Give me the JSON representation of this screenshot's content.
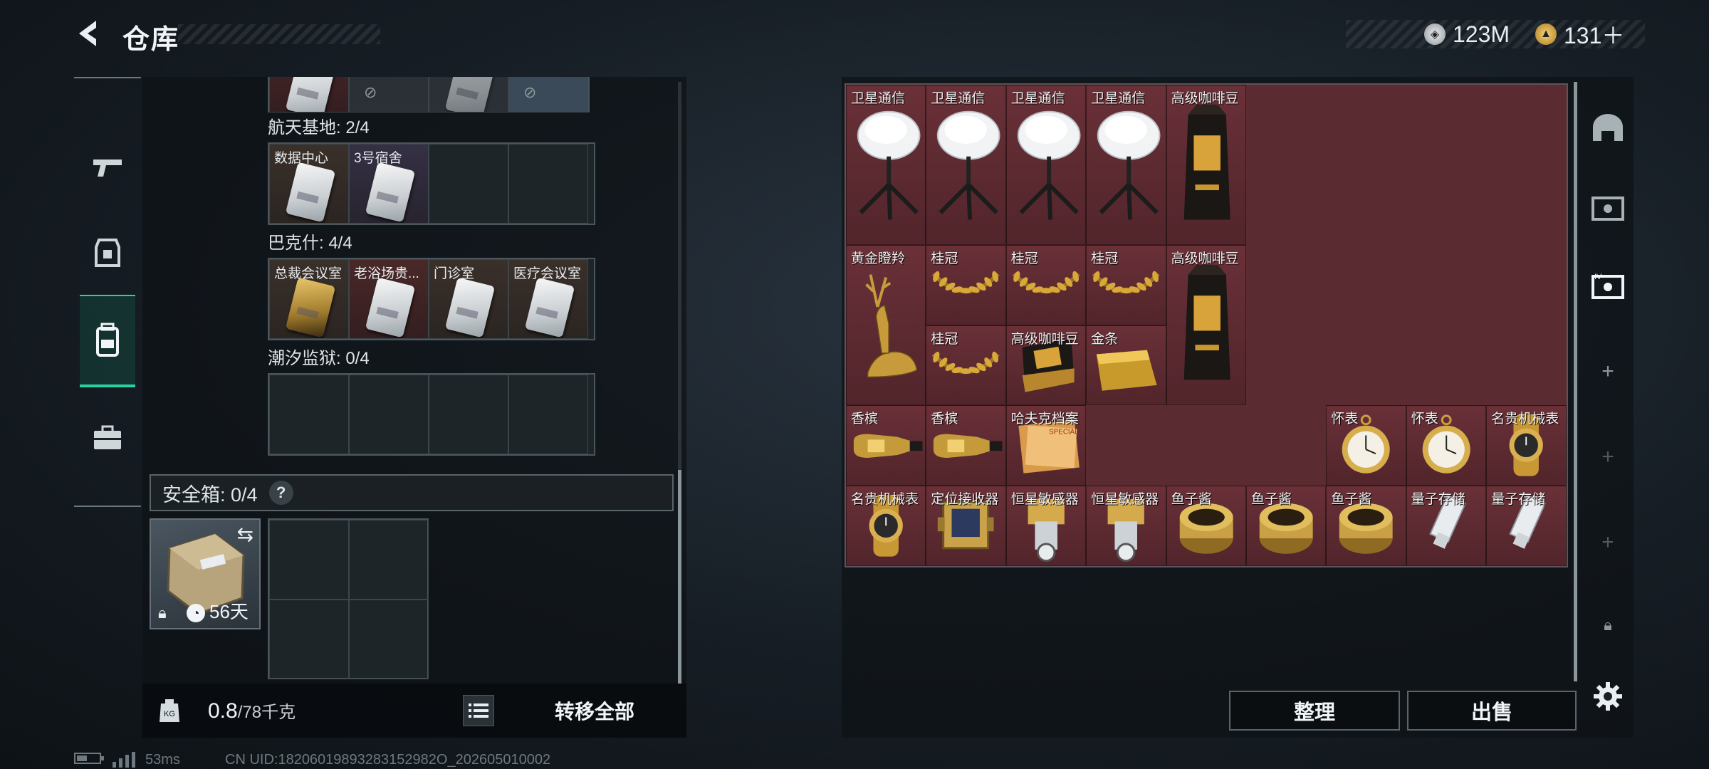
{
  "header": {
    "title": "仓库",
    "currency": [
      {
        "icon": "coin-icon",
        "value": "123M",
        "color": "#c8ccd0"
      },
      {
        "icon": "gold-coin-icon",
        "value": "131＋",
        "color": "#d8a63a"
      }
    ]
  },
  "left_sidebar": {
    "items": [
      {
        "icon": "gun-icon",
        "active": false
      },
      {
        "icon": "armor-icon",
        "active": false
      },
      {
        "icon": "backpack-icon",
        "active": true
      },
      {
        "icon": "briefcase-icon",
        "active": false
      }
    ]
  },
  "keycard_sections": [
    {
      "label": "航天基地: 2/4",
      "cards": [
        {
          "name": "数据中心",
          "style": "keycard"
        },
        {
          "name": "3号宿舍",
          "style": "keycard purple"
        },
        {
          "name": "",
          "style": "empty"
        },
        {
          "name": "",
          "style": "empty"
        }
      ]
    },
    {
      "label": "巴克什: 4/4",
      "cards": [
        {
          "name": "总裁会议室",
          "style": "keycard gold"
        },
        {
          "name": "老浴场贵...",
          "style": "keycard red"
        },
        {
          "name": "门诊室",
          "style": "keycard"
        },
        {
          "name": "医疗会议室",
          "style": "keycard"
        }
      ]
    },
    {
      "label": "潮汐监狱: 0/4",
      "cards": [
        {
          "name": "",
          "style": "empty"
        },
        {
          "name": "",
          "style": "empty"
        },
        {
          "name": "",
          "style": "empty"
        },
        {
          "name": "",
          "style": "empty"
        }
      ]
    }
  ],
  "safe_box": {
    "label": "安全箱: 0/4",
    "help": "?",
    "duration": "56天"
  },
  "weight": {
    "current": "0.8",
    "max": "/78千克"
  },
  "transfer_all_label": "转移全部",
  "items": [
    {
      "name": "卫星通信",
      "col": 0,
      "row": 0,
      "w": 1,
      "h": 2,
      "art": "dish"
    },
    {
      "name": "卫星通信",
      "col": 1,
      "row": 0,
      "w": 1,
      "h": 2,
      "art": "dish"
    },
    {
      "name": "卫星通信",
      "col": 2,
      "row": 0,
      "w": 1,
      "h": 2,
      "art": "dish"
    },
    {
      "name": "卫星通信",
      "col": 3,
      "row": 0,
      "w": 1,
      "h": 2,
      "art": "dish"
    },
    {
      "name": "高级咖啡豆",
      "col": 4,
      "row": 0,
      "w": 1,
      "h": 2,
      "art": "coffee"
    },
    {
      "name": "黄金瞪羚",
      "col": 0,
      "row": 2,
      "w": 1,
      "h": 2,
      "art": "gazelle"
    },
    {
      "name": "桂冠",
      "col": 1,
      "row": 2,
      "w": 1,
      "h": 1,
      "art": "laurel"
    },
    {
      "name": "桂冠",
      "col": 2,
      "row": 2,
      "w": 1,
      "h": 1,
      "art": "laurel"
    },
    {
      "name": "桂冠",
      "col": 3,
      "row": 2,
      "w": 1,
      "h": 1,
      "art": "laurel"
    },
    {
      "name": "高级咖啡豆",
      "col": 4,
      "row": 2,
      "w": 1,
      "h": 2,
      "art": "coffee"
    },
    {
      "name": "桂冠",
      "col": 1,
      "row": 3,
      "w": 1,
      "h": 1,
      "art": "laurel"
    },
    {
      "name": "高级咖啡豆",
      "col": 2,
      "row": 3,
      "w": 1,
      "h": 1,
      "art": "coffee-bag"
    },
    {
      "name": "金条",
      "col": 3,
      "row": 3,
      "w": 1,
      "h": 1,
      "art": "goldbar"
    },
    {
      "name": "香槟",
      "col": 0,
      "row": 4,
      "w": 1,
      "h": 1,
      "art": "champagne"
    },
    {
      "name": "香槟",
      "col": 1,
      "row": 4,
      "w": 1,
      "h": 1,
      "art": "champagne"
    },
    {
      "name": "哈夫克档案",
      "col": 2,
      "row": 4,
      "w": 1,
      "h": 1,
      "art": "files"
    },
    {
      "name": "怀表",
      "col": 6,
      "row": 4,
      "w": 1,
      "h": 1,
      "art": "pocketwatch"
    },
    {
      "name": "怀表",
      "col": 7,
      "row": 4,
      "w": 1,
      "h": 1,
      "art": "pocketwatch"
    },
    {
      "name": "名贵机械表",
      "col": 8,
      "row": 4,
      "w": 1,
      "h": 1,
      "art": "watch"
    },
    {
      "name": "名贵机械表",
      "col": 0,
      "row": 5,
      "w": 1,
      "h": 1,
      "art": "watch"
    },
    {
      "name": "定位接收器",
      "col": 1,
      "row": 5,
      "w": 1,
      "h": 1,
      "art": "gps"
    },
    {
      "name": "恒星敏感器",
      "col": 2,
      "row": 5,
      "w": 1,
      "h": 1,
      "art": "sensor"
    },
    {
      "name": "恒星敏感器",
      "col": 3,
      "row": 5,
      "w": 1,
      "h": 1,
      "art": "sensor"
    },
    {
      "name": "鱼子酱",
      "col": 4,
      "row": 5,
      "w": 1,
      "h": 1,
      "art": "caviar"
    },
    {
      "name": "鱼子酱",
      "col": 5,
      "row": 5,
      "w": 1,
      "h": 1,
      "art": "caviar"
    },
    {
      "name": "鱼子酱",
      "col": 6,
      "row": 5,
      "w": 1,
      "h": 1,
      "art": "caviar"
    },
    {
      "name": "量子存储",
      "col": 7,
      "row": 5,
      "w": 1,
      "h": 1,
      "art": "usb"
    },
    {
      "name": "量子存储",
      "col": 8,
      "row": 5,
      "w": 1,
      "h": 1,
      "art": "usb"
    }
  ],
  "actions": {
    "sort_label": "整理",
    "sell_label": "出售"
  },
  "right_sidebar": [
    {
      "icon": "bunker-icon"
    },
    {
      "icon": "container-icon"
    },
    {
      "icon": "container-selected-icon"
    },
    {
      "icon": "plus-icon"
    },
    {
      "icon": "plus-icon"
    },
    {
      "icon": "plus-icon"
    },
    {
      "icon": "lock-icon"
    },
    {
      "icon": "gear-icon"
    }
  ],
  "footer": {
    "ping": "53ms",
    "uid": "CN UID:18206019893283152982O_202605010002"
  }
}
